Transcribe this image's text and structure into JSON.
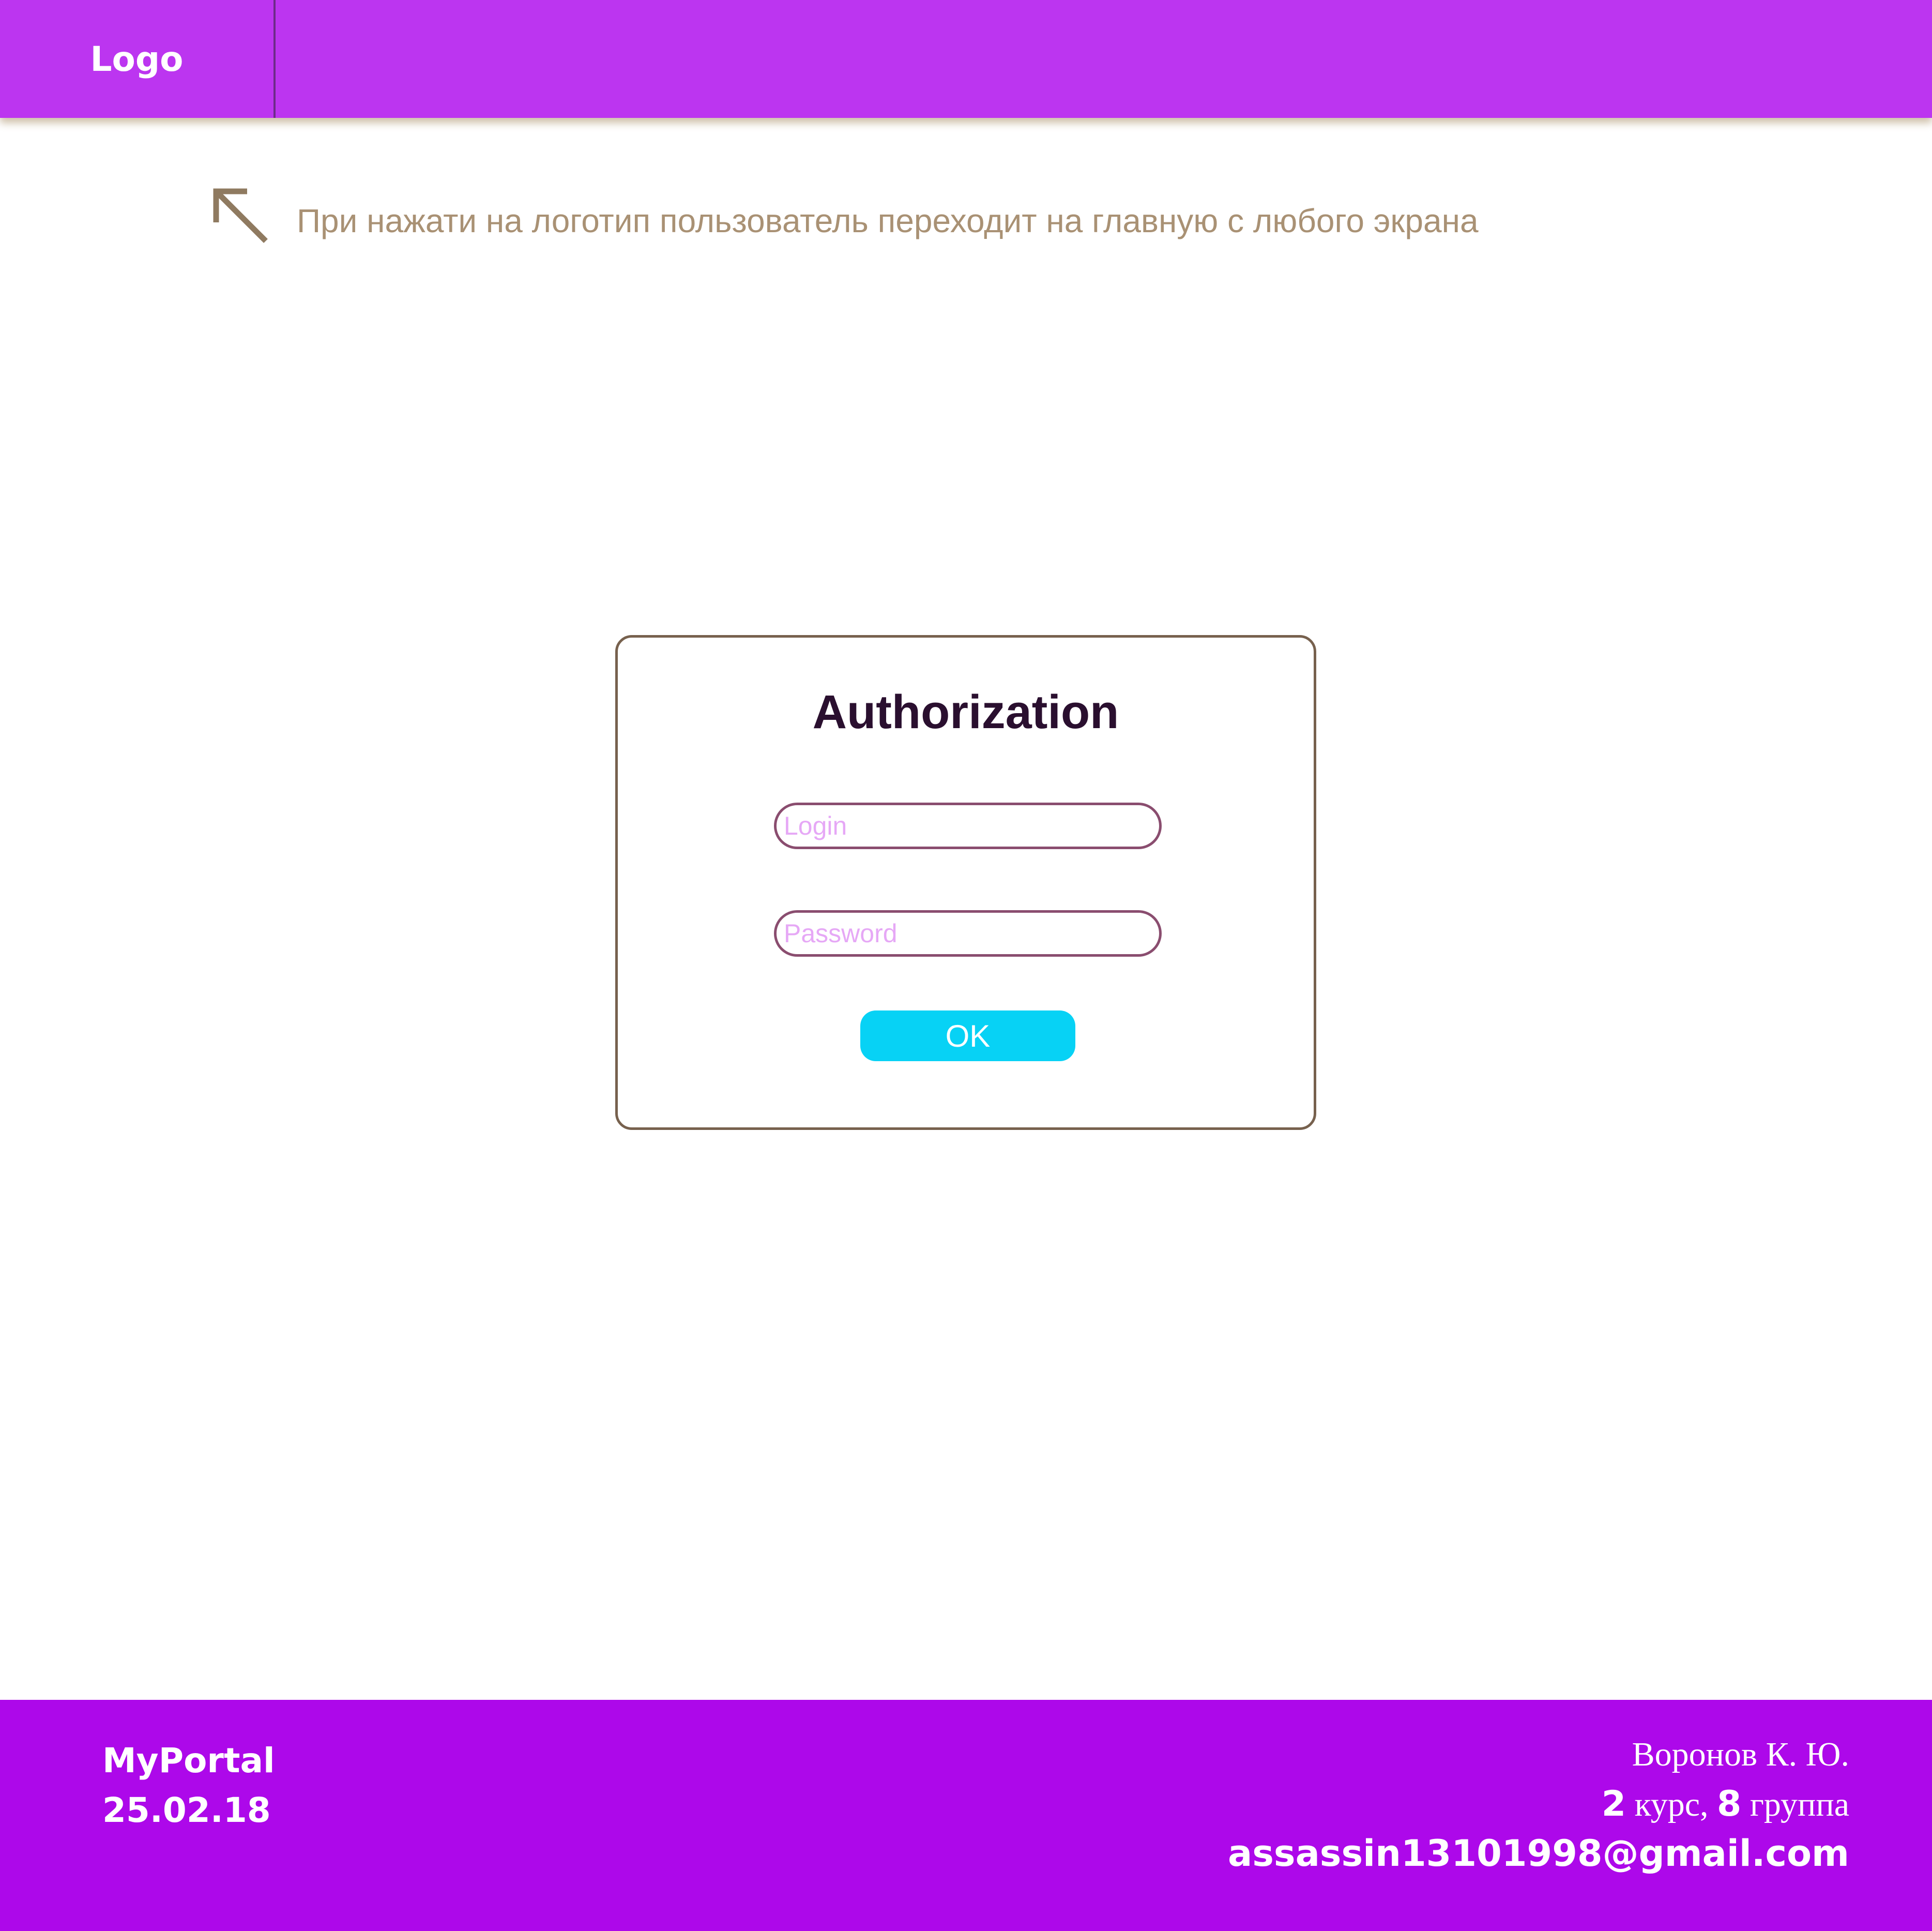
{
  "header": {
    "logo_label": "Logo"
  },
  "hint": {
    "arrow_icon": "arrow-up-left-icon",
    "text": "При нажати на логотип пользователь переходит на главную с любого экрана"
  },
  "auth": {
    "title": "Authorization",
    "login_placeholder": "Login",
    "login_value": "",
    "password_placeholder": "Password",
    "password_value": "",
    "ok_label": "OK"
  },
  "footer": {
    "portal_name": "MyPortal",
    "date": "25.02.18",
    "author_name": "Воронов К. Ю.",
    "course_number": "2",
    "course_word": " курс, ",
    "group_number": "8",
    "group_word": " группа",
    "email": "assassin13101998@gmail.com"
  },
  "colors": {
    "header_bg": "#bc35f0",
    "footer_bg": "#ad08ea",
    "button_bg": "#07d2f5",
    "hint_text": "#a99174",
    "card_border": "#77614e",
    "field_border": "#8a4d6f",
    "placeholder": "#e6a8f6"
  }
}
